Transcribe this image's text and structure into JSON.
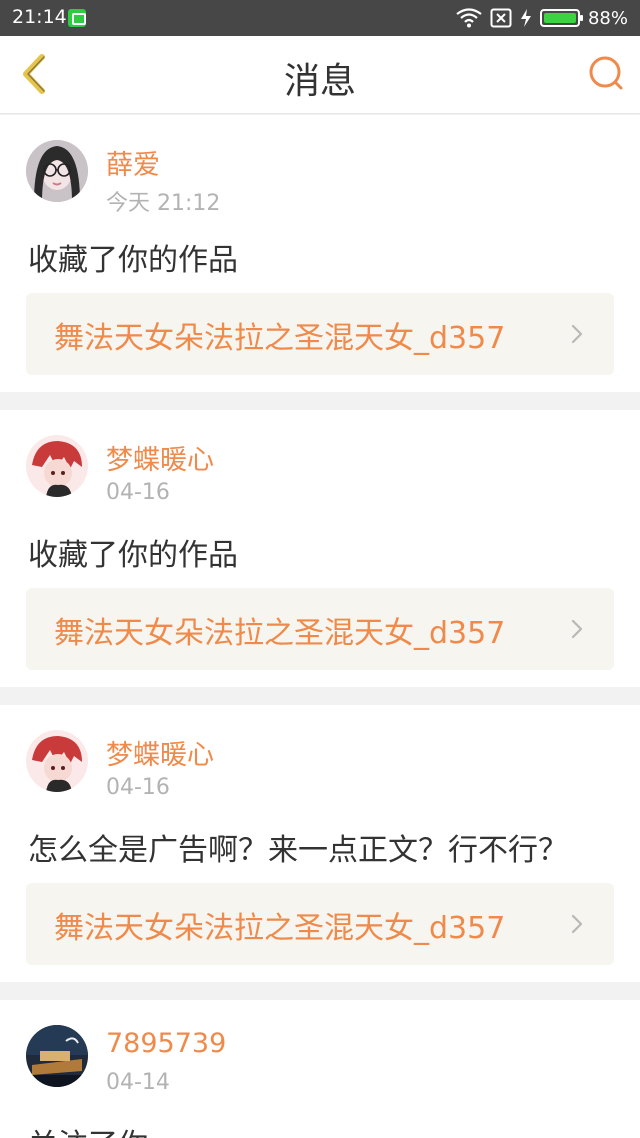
{
  "status": {
    "time": "21:14",
    "battery_percent": "88%",
    "battery_level": 0.88
  },
  "header": {
    "title": "消息"
  },
  "messages": [
    {
      "username": "薛爱",
      "time": "今天 21:12",
      "text": "收藏了你的作品",
      "work": "舞法天女朵法拉之圣混天女_d357"
    },
    {
      "username": "梦蝶暖心",
      "time": "04-16",
      "text": "收藏了你的作品",
      "work": "舞法天女朵法拉之圣混天女_d357"
    },
    {
      "username": "梦蝶暖心",
      "time": "04-16",
      "text": "怎么全是广告啊？来一点正文？行不行？",
      "work": "舞法天女朵法拉之圣混天女_d357"
    },
    {
      "username": "7895739",
      "time": "04-14",
      "text": "关注了你"
    }
  ],
  "colors": {
    "accent": "#f08a4b",
    "back_icon": "#e6c44a",
    "status_bar": "#474747"
  }
}
